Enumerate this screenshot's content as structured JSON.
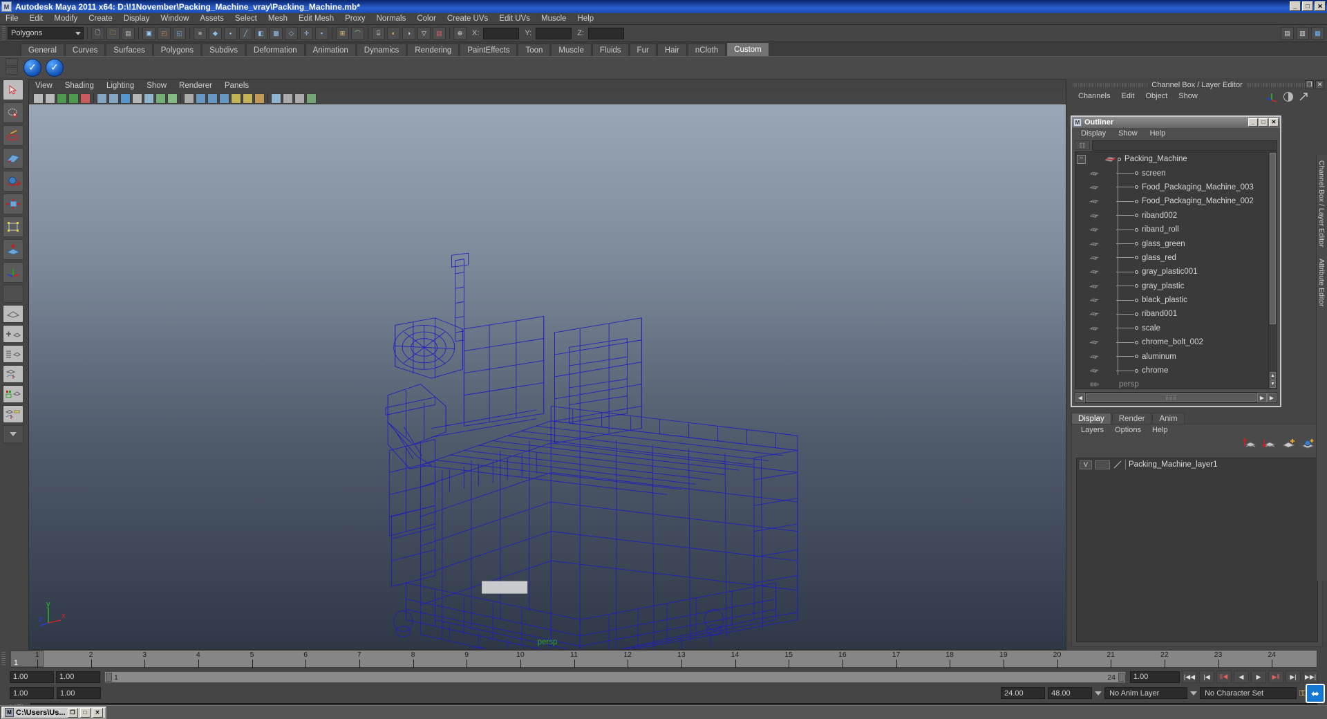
{
  "window": {
    "title": "Autodesk Maya 2011 x64: D:\\!1November\\Packing_Machine_vray\\Packing_Machine.mb*",
    "minimize": "_",
    "maximize": "□",
    "close": "✕"
  },
  "menubar": {
    "items": [
      "File",
      "Edit",
      "Modify",
      "Create",
      "Display",
      "Window",
      "Assets",
      "Select",
      "Mesh",
      "Edit Mesh",
      "Proxy",
      "Normals",
      "Color",
      "Create UVs",
      "Edit UVs",
      "Muscle",
      "Help"
    ]
  },
  "statusbar": {
    "selection_mode": "Polygons",
    "x_label": "X:",
    "y_label": "Y:",
    "z_label": "Z:",
    "x_value": "",
    "y_value": "",
    "z_value": ""
  },
  "shelf": {
    "tabs": [
      "General",
      "Curves",
      "Surfaces",
      "Polygons",
      "Subdivs",
      "Deformation",
      "Animation",
      "Dynamics",
      "Rendering",
      "PaintEffects",
      "Toon",
      "Muscle",
      "Fluids",
      "Fur",
      "Hair",
      "nCloth",
      "Custom"
    ],
    "active_tab": "Custom",
    "buttons": [
      "vray-render-icon",
      "vray-rt-icon"
    ]
  },
  "viewport": {
    "menus": [
      "View",
      "Shading",
      "Lighting",
      "Show",
      "Renderer",
      "Panels"
    ],
    "camera_label": "persp",
    "axis": {
      "x": "x",
      "y": "y",
      "z": "z",
      "x_color": "#e02020",
      "y_color": "#20c020",
      "z_color": "#2040e0"
    },
    "wireframe_color": "#1f1fbe",
    "bg_top": "#9aa7b5",
    "bg_bottom": "#2f3846"
  },
  "channelbox": {
    "title": "Channel Box / Layer Editor",
    "menus": [
      "Channels",
      "Edit",
      "Object",
      "Show"
    ],
    "restore_btn": "❐",
    "close_btn": "✕"
  },
  "outliner": {
    "title": "Outliner",
    "minimize": "_",
    "maximize": "□",
    "close": "✕",
    "menus": [
      "Display",
      "Show",
      "Help"
    ],
    "search_value": "",
    "root": {
      "label": "Packing_Machine",
      "expander": "−"
    },
    "items": [
      "screen",
      "Food_Packaging_Machine_003",
      "Food_Packaging_Machine_002",
      "riband002",
      "riband_roll",
      "glass_green",
      "glass_red",
      "gray_plastic001",
      "gray_plastic",
      "black_plastic",
      "riband001",
      "scale",
      "chrome_bolt_002",
      "aluminum",
      "chrome"
    ],
    "partial_item": "persp",
    "scroll_up": "▲",
    "scroll_down": "▼",
    "hscroll_left": "◀",
    "hscroll_right": "▶"
  },
  "layer_editor": {
    "tabs": [
      "Display",
      "Render",
      "Anim"
    ],
    "active_tab": "Display",
    "menus": [
      "Layers",
      "Options",
      "Help"
    ],
    "layers": [
      {
        "visibility": "V",
        "display_type": "",
        "name": "Packing_Machine_layer1"
      }
    ],
    "icons": [
      "move-layer-up-icon",
      "move-layer-down-icon",
      "new-layer-icon",
      "new-layer-from-selected-icon"
    ]
  },
  "right_tabs": [
    "Channel Box / Layer Editor",
    "Attribute Editor"
  ],
  "timeline": {
    "start_frame": "1",
    "current_frame_label": "1",
    "ticks": [
      "1",
      "2",
      "3",
      "4",
      "5",
      "6",
      "7",
      "8",
      "9",
      "10",
      "11",
      "12",
      "13",
      "14",
      "15",
      "16",
      "17",
      "18",
      "19",
      "20",
      "21",
      "22",
      "23",
      "24"
    ],
    "current_time": "1.00"
  },
  "range_slider": {
    "anim_start": "1.00",
    "range_start": "1.00",
    "range_bar_start": "1",
    "range_bar_end": "24",
    "range_end": "24.00",
    "anim_end": "48.00",
    "anim_layer": "No Anim Layer",
    "character_set": "No Character Set"
  },
  "playback": {
    "buttons": [
      "go-to-start-icon",
      "step-back-keyframe-icon",
      "step-back-frame-icon",
      "play-backwards-icon",
      "play-forwards-icon",
      "step-forward-frame-icon",
      "step-forward-keyframe-icon",
      "go-to-end-icon"
    ]
  },
  "command_line": {
    "label": "MEL",
    "value": ""
  },
  "taskbar": {
    "item_title": "C:\\Users\\Us...",
    "restore": "❐",
    "maximize": "□",
    "close": "✕"
  },
  "toolbox": {
    "tools": [
      "select-tool",
      "lasso-select-tool",
      "paint-select-tool",
      "move-tool",
      "rotate-tool",
      "scale-tool",
      "universal-manipulator-tool",
      "soft-modification-tool",
      "show-manipulator-tool",
      "blank-tool",
      "single-perspective-layout",
      "four-view-layout",
      "outliner-persp-layout",
      "persp-graph-layout",
      "hypershade-persp-layout",
      "persp-graph-outliner-layout",
      "more-layouts"
    ]
  }
}
